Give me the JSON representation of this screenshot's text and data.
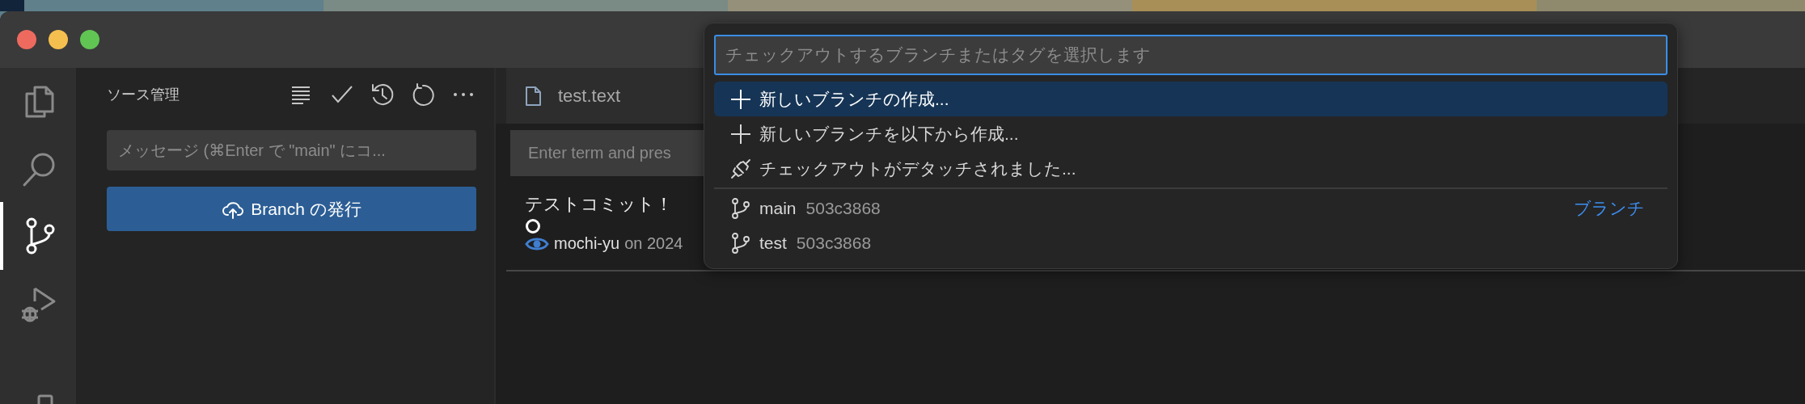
{
  "window": {
    "traffic_lights": [
      {
        "color": "#ee6a5f"
      },
      {
        "color": "#f5bf4f"
      },
      {
        "color": "#61c554"
      }
    ]
  },
  "activity_bar": {
    "items": [
      {
        "selected": false
      },
      {
        "selected": false
      },
      {
        "selected": true
      },
      {
        "selected": false
      },
      {
        "selected": false
      }
    ]
  },
  "sidebar": {
    "title": "ソース管理",
    "message_placeholder": "メッセージ (⌘Enter で \"main\" にコ...",
    "publish_button": "Branch の発行"
  },
  "editor": {
    "tab": {
      "label": "test.text"
    },
    "search_placeholder": "Enter term and pres",
    "commit": {
      "message": "テストコミット！",
      "author": "mochi-yu",
      "date": "on 2024"
    }
  },
  "quick_pick": {
    "placeholder": "チェックアウトするブランチまたはタグを選択します",
    "items": [
      {
        "kind": "plus",
        "label": "新しいブランチの作成...",
        "selected": true
      },
      {
        "kind": "plus",
        "label": "新しいブランチを以下から作成...",
        "selected": false
      },
      {
        "kind": "plug",
        "label": "チェックアウトがデタッチされました...",
        "selected": false
      },
      {
        "kind": "branch",
        "label": "main",
        "hash": "503c3868",
        "group_label": "ブランチ",
        "separator": true,
        "selected": false
      },
      {
        "kind": "branch",
        "label": "test",
        "hash": "503c3868",
        "selected": false
      }
    ]
  }
}
